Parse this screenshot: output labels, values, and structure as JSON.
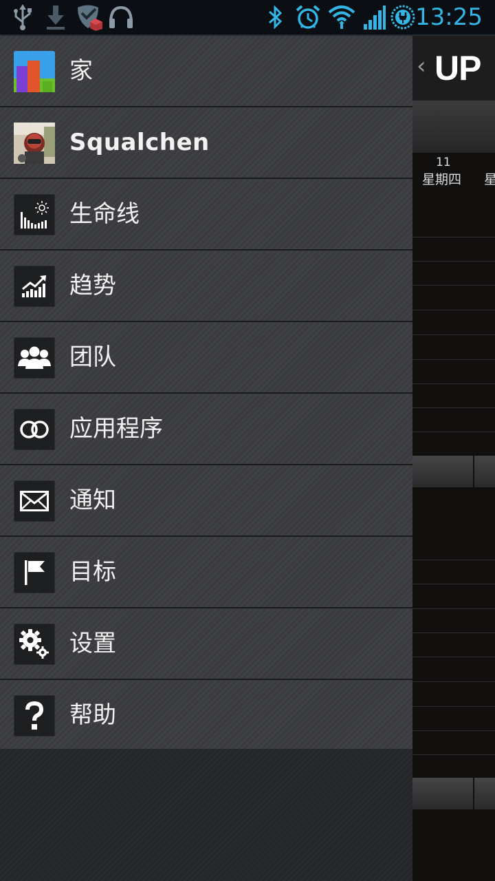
{
  "status_bar": {
    "time": "13:25",
    "icons": [
      "usb-icon",
      "download-icon",
      "vpn-shield-icon",
      "headphones-icon",
      "bluetooth-icon",
      "alarm-icon",
      "wifi-icon",
      "signal-icon",
      "battery-charging-icon"
    ],
    "accent_color": "#33b5e5"
  },
  "background_app": {
    "back_glyph": "‹",
    "title": "UP",
    "day_number": "11",
    "day_name": "星期四",
    "day_name_next": "星"
  },
  "drawer": {
    "items": [
      {
        "label": "家",
        "icon": "home-app-icon"
      },
      {
        "label": "Squalchen",
        "icon": "avatar"
      },
      {
        "label": "生命线",
        "icon": "lifeline-icon"
      },
      {
        "label": "趋势",
        "icon": "trends-icon"
      },
      {
        "label": "团队",
        "icon": "team-icon"
      },
      {
        "label": "应用程序",
        "icon": "apps-rings-icon"
      },
      {
        "label": "通知",
        "icon": "mail-icon"
      },
      {
        "label": "目标",
        "icon": "flag-icon"
      },
      {
        "label": "设置",
        "icon": "gear-icon"
      },
      {
        "label": "帮助",
        "icon": "question-icon"
      }
    ]
  }
}
